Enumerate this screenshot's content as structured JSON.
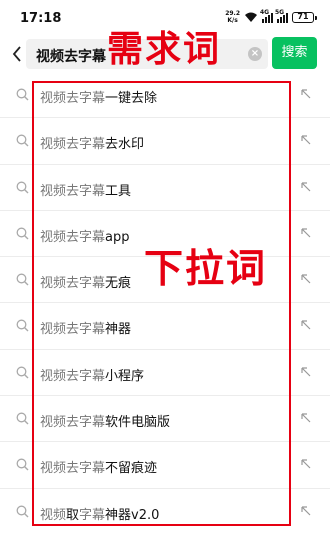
{
  "status_bar": {
    "time": "17:18",
    "net_speed_value": "29.2",
    "net_speed_unit": "K/s",
    "signal1_label": "4G",
    "signal2_label": "5G",
    "battery": "71"
  },
  "search": {
    "query": "视频去字幕",
    "button_label": "搜索"
  },
  "suggestions": [
    {
      "hl": "视频去字幕",
      "rest": "一键去除"
    },
    {
      "hl": "视频去字幕",
      "rest": "去水印"
    },
    {
      "hl": "视频去字幕",
      "rest": "工具"
    },
    {
      "hl": "视频去字幕",
      "rest": "app"
    },
    {
      "hl": "视频去字幕",
      "rest": "无痕"
    },
    {
      "hl": "视频去字幕",
      "rest": "神器"
    },
    {
      "hl": "视频去字幕",
      "rest": "小程序"
    },
    {
      "hl": "视频去字幕",
      "rest": "软件电脑版"
    },
    {
      "hl": "视频去字幕",
      "rest": "不留痕迹"
    },
    {
      "hl": "视频",
      "hl2": "取",
      "hl3": "字幕",
      "rest": "神器v2.0"
    }
  ],
  "annotations": {
    "top_label": "需求词",
    "middle_label": "下拉词",
    "color": "#e60012"
  },
  "colors": {
    "accent": "#07c160"
  }
}
